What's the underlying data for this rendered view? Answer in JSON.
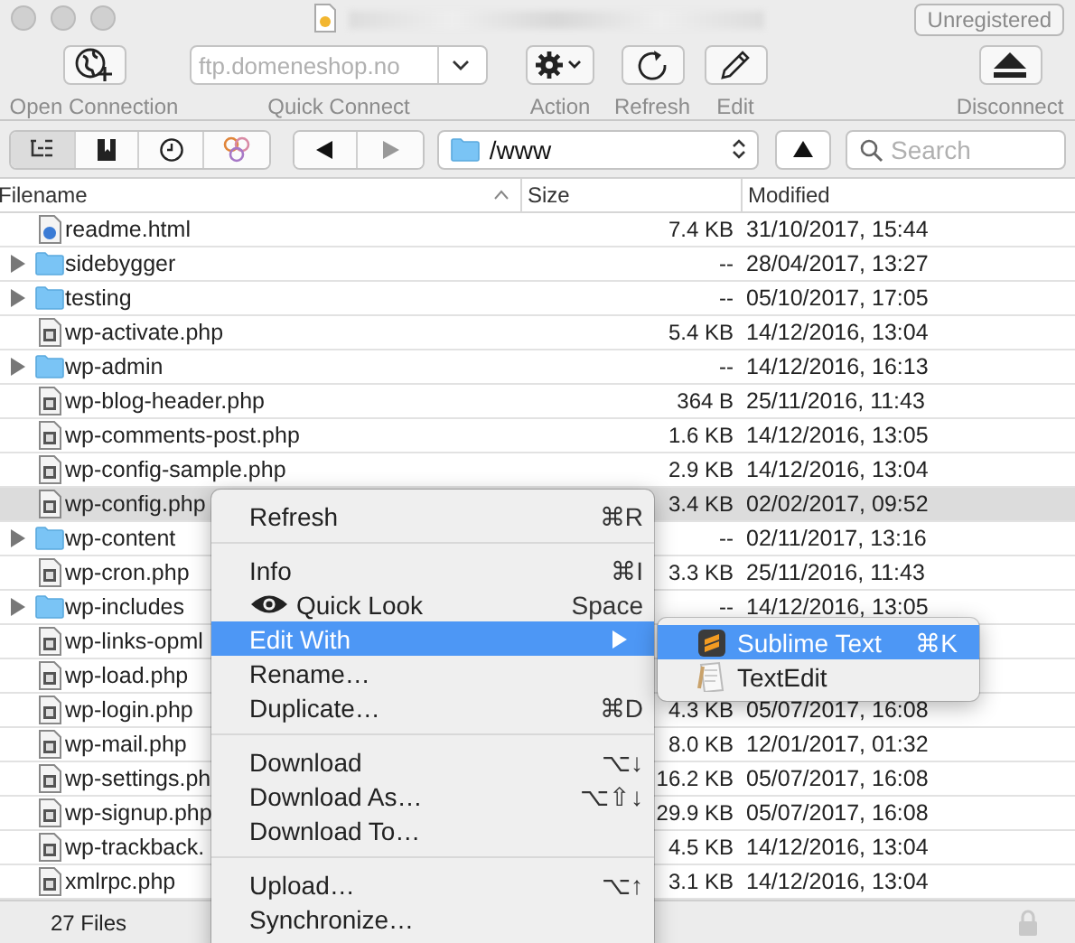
{
  "window": {
    "badge": "Unregistered"
  },
  "toolbar": {
    "items": [
      {
        "kind": "button",
        "label": "Open Connection"
      },
      {
        "kind": "combo",
        "placeholder": "ftp.domeneshop.no",
        "label": "Quick Connect"
      },
      {
        "kind": "menu",
        "label": "Action"
      },
      {
        "kind": "button",
        "label": "Refresh"
      },
      {
        "kind": "button",
        "label": "Edit"
      },
      {
        "kind": "button",
        "label": "Disconnect"
      }
    ]
  },
  "navigation": {
    "views": [
      {
        "selected": true
      },
      {
        "selected": false
      },
      {
        "selected": false
      },
      {
        "selected": false
      }
    ],
    "path": "/www",
    "search": {
      "placeholder": "Search"
    }
  },
  "table": {
    "columns": [
      "Filename",
      "Size",
      "Modified"
    ],
    "rows": [
      {
        "kind": "html",
        "name": "readme.html",
        "size": "7.4 KB",
        "modified": "31/10/2017, 15:44",
        "selected": false
      },
      {
        "kind": "folder",
        "name": "sidebygger",
        "size": "--",
        "modified": "28/04/2017, 13:27",
        "selected": false
      },
      {
        "kind": "folder",
        "name": "testing",
        "size": "--",
        "modified": "05/10/2017, 17:05",
        "selected": false
      },
      {
        "kind": "file",
        "name": "wp-activate.php",
        "size": "5.4 KB",
        "modified": "14/12/2016, 13:04",
        "selected": false
      },
      {
        "kind": "folder",
        "name": "wp-admin",
        "size": "--",
        "modified": "14/12/2016, 16:13",
        "selected": false
      },
      {
        "kind": "file",
        "name": "wp-blog-header.php",
        "size": "364 B",
        "modified": "25/11/2016, 11:43",
        "selected": false
      },
      {
        "kind": "file",
        "name": "wp-comments-post.php",
        "size": "1.6 KB",
        "modified": "14/12/2016, 13:05",
        "selected": false
      },
      {
        "kind": "file",
        "name": "wp-config-sample.php",
        "size": "2.9 KB",
        "modified": "14/12/2016, 13:04",
        "selected": false
      },
      {
        "kind": "file",
        "name": "wp-config.php",
        "size": "3.4 KB",
        "modified": "02/02/2017, 09:52",
        "selected": true
      },
      {
        "kind": "folder",
        "name": "wp-content",
        "size": "--",
        "modified": "02/11/2017, 13:16",
        "selected": false
      },
      {
        "kind": "file",
        "name": "wp-cron.php",
        "size": "3.3 KB",
        "modified": "25/11/2016, 11:43",
        "selected": false
      },
      {
        "kind": "folder",
        "name": "wp-includes",
        "size": "--",
        "modified": "14/12/2016, 13:05",
        "selected": false
      },
      {
        "kind": "file",
        "name": "wp-links-opml",
        "selected": false
      },
      {
        "kind": "file",
        "name": "wp-load.php",
        "selected": false
      },
      {
        "kind": "file",
        "name": "wp-login.php",
        "size": "4.3 KB",
        "modified": "05/07/2017, 16:08",
        "selected": false
      },
      {
        "kind": "file",
        "name": "wp-mail.php",
        "size": "8.0 KB",
        "modified": "12/01/2017, 01:32",
        "selected": false
      },
      {
        "kind": "file",
        "name": "wp-settings.ph",
        "size": "16.2 KB",
        "modified": "05/07/2017, 16:08",
        "selected": false
      },
      {
        "kind": "file",
        "name": "wp-signup.php",
        "size": "29.9 KB",
        "modified": "05/07/2017, 16:08",
        "selected": false
      },
      {
        "kind": "file",
        "name": "wp-trackback.",
        "size": "4.5 KB",
        "modified": "14/12/2016, 13:04",
        "selected": false
      },
      {
        "kind": "file",
        "name": "xmlrpc.php",
        "size": "3.1 KB",
        "modified": "14/12/2016, 13:04",
        "selected": false
      }
    ]
  },
  "status_bar": {
    "text": "27 Files"
  },
  "context_menu": {
    "items": [
      {
        "kind": "item",
        "label": "Refresh",
        "shortcut": "⌘R",
        "selected": false
      },
      {
        "kind": "separator"
      },
      {
        "kind": "item",
        "label": "Info",
        "shortcut": "⌘I",
        "selected": false
      },
      {
        "kind": "preview",
        "label": "Quick Look",
        "shortcut": "Space",
        "selected": false
      },
      {
        "kind": "submenu",
        "label": "Edit With",
        "selected": true
      },
      {
        "kind": "item",
        "label": "Rename…",
        "selected": false
      },
      {
        "kind": "item",
        "label": "Duplicate…",
        "shortcut": "⌘D",
        "selected": false
      },
      {
        "kind": "separator"
      },
      {
        "kind": "item",
        "label": "Download",
        "shortcut": "⌥↓",
        "selected": false
      },
      {
        "kind": "item",
        "label": "Download As…",
        "shortcut": "⌥⇧↓",
        "selected": false
      },
      {
        "kind": "item",
        "label": "Download To…",
        "selected": false
      },
      {
        "kind": "separator"
      },
      {
        "kind": "item",
        "label": "Upload…",
        "shortcut": "⌥↑",
        "selected": false
      },
      {
        "kind": "item",
        "label": "Synchronize…",
        "selected": false
      }
    ],
    "submenu": [
      {
        "label": "Sublime Text",
        "shortcut": "⌘K",
        "selected": true
      },
      {
        "label": "TextEdit",
        "selected": false
      }
    ]
  }
}
